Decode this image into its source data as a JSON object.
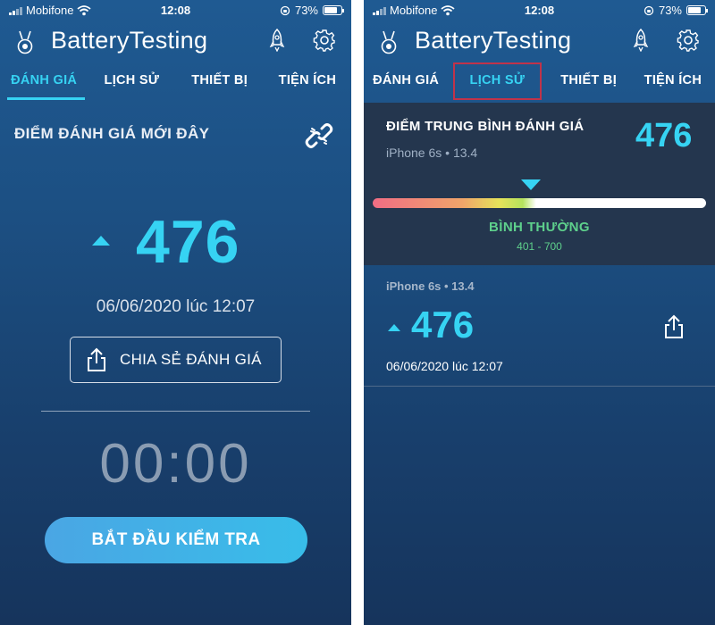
{
  "status": {
    "carrier": "Mobifone",
    "time": "12:08",
    "battery_percent": "73%"
  },
  "app": {
    "title": "BatteryTesting"
  },
  "tabs": [
    "ĐÁNH GIÁ",
    "LỊCH SỬ",
    "THIẾT BỊ",
    "TIỆN ÍCH"
  ],
  "left_screen": {
    "active_tab_index": 0,
    "recent_label": "ĐIỂM ĐÁNH GIÁ MỚI ĐÂY",
    "score": "476",
    "date": "06/06/2020 lúc 12:07",
    "share_label": "CHIA SẺ ĐÁNH GIÁ",
    "timer": "00:00",
    "start_label": "BẮT ĐẦU KIỂM TRA"
  },
  "right_screen": {
    "active_tab_index": 1,
    "average": {
      "title": "ĐIỂM TRUNG BÌNH ĐÁNH GIÁ",
      "device": "iPhone 6s • 13.4",
      "score": "476",
      "range_name": "BÌNH THƯỜNG",
      "range_values": "401 - 700"
    },
    "history": [
      {
        "device": "iPhone 6s • 13.4",
        "score": "476",
        "date": "06/06/2020 lúc 12:07"
      }
    ]
  },
  "colors": {
    "accent": "#36d3f3",
    "highlight_box": "#c0334a",
    "range_good": "#5ed08c",
    "background": "#1c4f82"
  },
  "icons": [
    "wifi-icon",
    "rotation-lock-icon",
    "battery-icon",
    "medal-icon",
    "rocket-icon",
    "gear-icon",
    "unlink-icon",
    "share-icon"
  ]
}
